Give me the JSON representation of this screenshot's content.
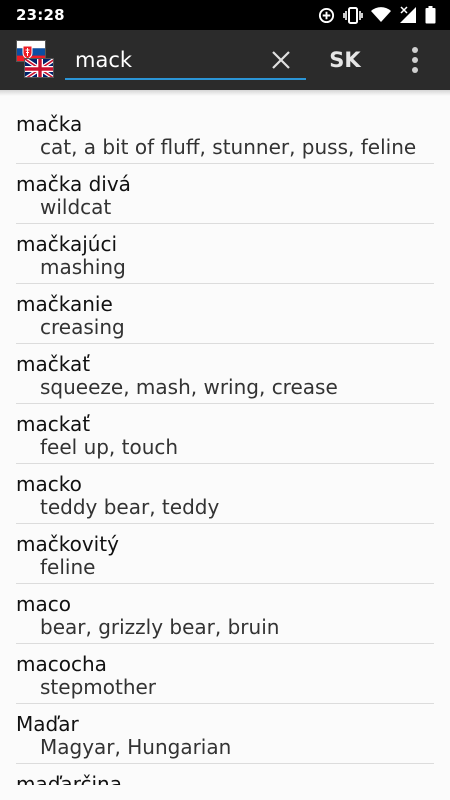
{
  "status_bar": {
    "time": "23:28",
    "icons": [
      "data-saver-icon",
      "vibrate-icon",
      "wifi-icon",
      "signal-icon",
      "battery-icon"
    ]
  },
  "toolbar": {
    "search": {
      "value": "mack",
      "placeholder": ""
    },
    "language_label": "SK",
    "flags": [
      "slovak-flag-icon",
      "uk-flag-icon"
    ]
  },
  "colors": {
    "toolbar_bg": "#2b2b2b",
    "search_underline": "#2b95d6",
    "list_bg": "#fbfbfb"
  },
  "entries": [
    {
      "term": "mačka",
      "translation": "cat, a bit of fluff, stunner, puss, feline"
    },
    {
      "term": "mačka divá",
      "translation": "wildcat"
    },
    {
      "term": "mačkajúci",
      "translation": "mashing"
    },
    {
      "term": "mačkanie",
      "translation": "creasing"
    },
    {
      "term": "mačkať",
      "translation": "squeeze, mash, wring, crease"
    },
    {
      "term": "mackať",
      "translation": "feel up, touch"
    },
    {
      "term": "macko",
      "translation": "teddy bear, teddy"
    },
    {
      "term": "mačkovitý",
      "translation": "feline"
    },
    {
      "term": "maco",
      "translation": "bear, grizzly bear, bruin"
    },
    {
      "term": "macocha",
      "translation": "stepmother"
    },
    {
      "term": "Maďar",
      "translation": "Magyar, Hungarian"
    },
    {
      "term": "maďarčina",
      "translation": ""
    }
  ]
}
